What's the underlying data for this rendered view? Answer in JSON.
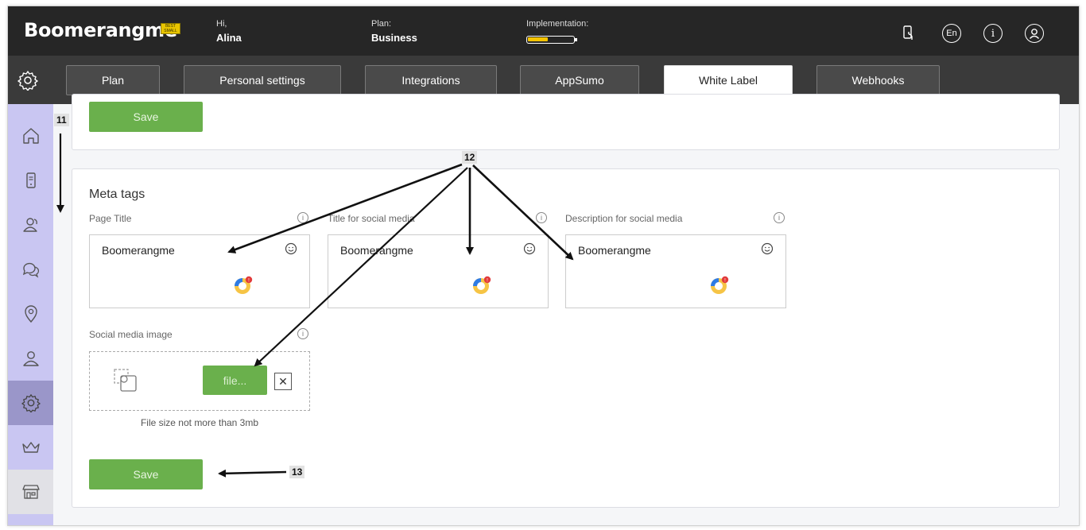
{
  "header": {
    "logo": "Boomerangme",
    "logo_badge": "Best Small Business",
    "greeting_label": "Hi,",
    "user_name": "Alina",
    "plan_label": "Plan:",
    "plan_value": "Business",
    "implementation_label": "Implementation:",
    "implementation_progress": 0.45,
    "language": "En",
    "accent_color": "#f5c400"
  },
  "nav": {
    "tabs": [
      {
        "label": "Plan"
      },
      {
        "label": "Personal settings"
      },
      {
        "label": "Integrations"
      },
      {
        "label": "AppSumo"
      },
      {
        "label": "White Label",
        "active": true
      },
      {
        "label": "Webhooks"
      }
    ]
  },
  "sidebar": {
    "items": [
      {
        "icon": "home-icon"
      },
      {
        "icon": "card-device-icon"
      },
      {
        "icon": "customers-icon"
      },
      {
        "icon": "chat-icon"
      },
      {
        "icon": "location-pin-icon"
      },
      {
        "icon": "user-icon"
      },
      {
        "icon": "gear-icon",
        "active": true
      },
      {
        "icon": "crown-icon"
      },
      {
        "icon": "store-icon"
      }
    ],
    "color": "#c9c6f2"
  },
  "top_section": {
    "save_label": "Save"
  },
  "meta_tags": {
    "title": "Meta tags",
    "fields": [
      {
        "label": "Page Title",
        "value": "Boomerangme"
      },
      {
        "label": "Title for social media",
        "value": "Boomerangme"
      },
      {
        "label": "Description for social media",
        "value": "Boomerangme"
      }
    ],
    "social_image": {
      "label": "Social media image",
      "file_button": "file...",
      "hint": "File size not more than 3mb"
    },
    "save_label": "Save",
    "save_color": "#6ab04c"
  },
  "annotations": {
    "n11": "11",
    "n12": "12",
    "n13": "13"
  }
}
